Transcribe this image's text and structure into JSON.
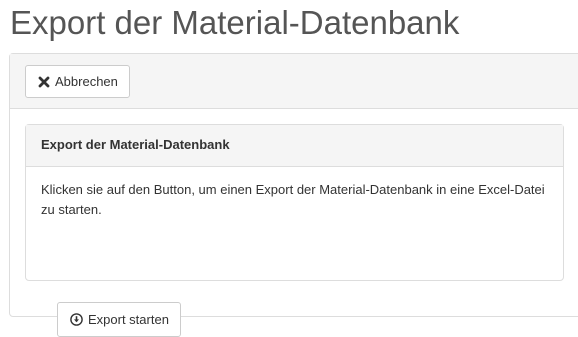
{
  "page": {
    "title": "Export der Material-Datenbank"
  },
  "toolbar": {
    "cancel_label": "Abbrechen",
    "cancel_icon": "times-icon"
  },
  "panel": {
    "heading": "Export der Material-Datenbank",
    "description": "Klicken sie auf den Button, um einen Export der Material-Datenbank in eine Excel-Datei zu starten.",
    "export_label": "Export starten",
    "export_icon": "download-circle-icon"
  },
  "colors": {
    "title": "#555555",
    "text": "#333333",
    "panel_header_bg": "#f5f5f5",
    "border": "#dddddd"
  }
}
